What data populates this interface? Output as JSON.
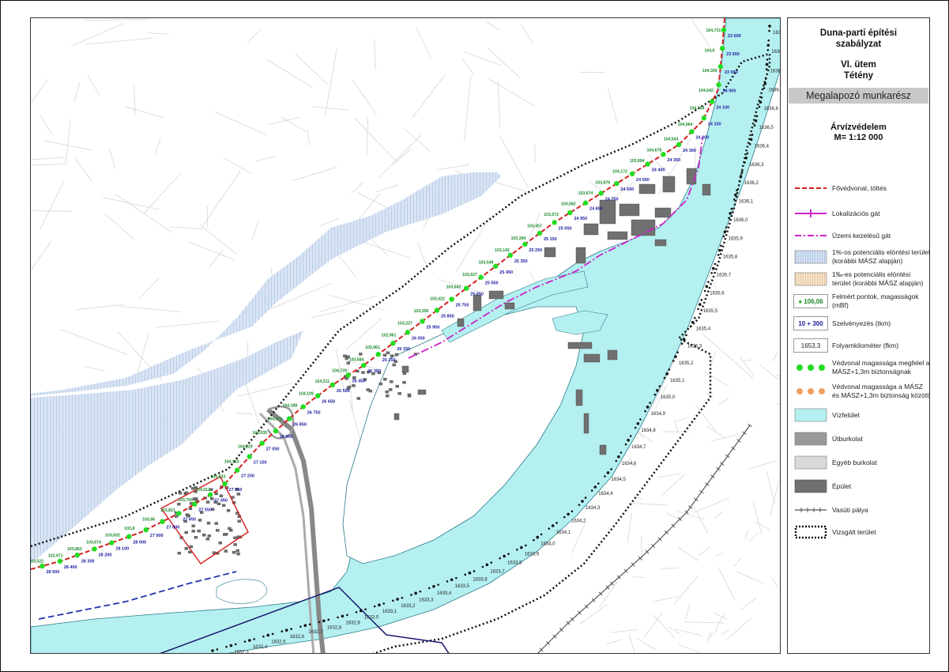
{
  "legend_header": {
    "title_1": "Duna-parti építési",
    "title_2": "szabályzat",
    "stage": "VI. ütem",
    "district": "Tétény",
    "banner": "Megalapozó munkarész",
    "theme": "Árvízvédelem",
    "scale": "M= 1:12 000"
  },
  "legend_items": [
    {
      "label": "Fővédvonal, töltés",
      "symbol": "red-dashed-line",
      "color": "#d42020"
    },
    {
      "label": "Lokalizációs gát",
      "symbol": "magenta-ticked-line",
      "color": "#cc22cc"
    },
    {
      "label": "Üzemi kezelésű gát",
      "symbol": "magenta-dashdot-line",
      "color": "#cc22cc"
    },
    {
      "label": "1%-os potenciális elöntési terület (korábbi MÁSZ alapján)",
      "symbol": "blue-hatch",
      "color": "#9db8dc"
    },
    {
      "label": "1‰-es potenciális elöntési terület (korábbi MÁSZ alapján)",
      "symbol": "orange-hatch",
      "color": "#e8c79a"
    },
    {
      "label": "Felmért pontok, magasságok (mBf)",
      "symbol": "survey-point",
      "sample": "106,06",
      "color": "#1a8a2a"
    },
    {
      "label": "Szelvényezés (tkm)",
      "symbol": "chainage",
      "sample": "10 + 300",
      "color": "#1a1aa0"
    },
    {
      "label": "Folyamkilométer (fkm)",
      "symbol": "river-km-box",
      "sample": "1653,3"
    },
    {
      "label": "Védvonal magassága megfelel a MÁSZ+1,3m biztonságnak",
      "symbol": "green-dots",
      "color": "#22dd22"
    },
    {
      "label": "Védvonal magassága a MÁSZ és MÁSZ+1,3m biztonság közötti",
      "symbol": "orange-dots",
      "color": "#f0a060"
    },
    {
      "label": "Vízfelület",
      "symbol": "water-fill",
      "color": "#b5f0f0"
    },
    {
      "label": "Útburkolat",
      "symbol": "gray-fill",
      "color": "#999999"
    },
    {
      "label": "Egyéb burkolat",
      "symbol": "lightgray-fill",
      "color": "#d9d9d9"
    },
    {
      "label": "Épület",
      "symbol": "darkgray-fill",
      "color": "#707070"
    },
    {
      "label": "Vasúti pálya",
      "symbol": "rail-line",
      "color": "#555555"
    },
    {
      "label": "Vizsgált terület",
      "symbol": "black-dotted-outline",
      "color": "#111111"
    }
  ],
  "river_km_labels": [
    "1637",
    "1636,9",
    "1636,8",
    "1636,7",
    "1636,6",
    "1636,5",
    "1636,4",
    "1636,3",
    "1636,2",
    "1636,1",
    "1636,0",
    "1635,9",
    "1635,8",
    "1635,7",
    "1635,6",
    "1635,5",
    "1635,4",
    "1635,3",
    "1635,2",
    "1635,1",
    "1635,0",
    "1634,9",
    "1634,8",
    "1634,7",
    "1634,6",
    "1634,5",
    "1634,4",
    "1634,3",
    "1634,2",
    "1634,1",
    "1634,0",
    "1633,9",
    "1633,8",
    "1633,7",
    "1633,6",
    "1633,5",
    "1633,4",
    "1633,3",
    "1633,2",
    "1633,1",
    "1633,0",
    "1632,9",
    "1632,8",
    "1632,7",
    "1632,6",
    "1632,5",
    "1632,4",
    "1632,3",
    "1632,2"
  ],
  "chainage_labels": [
    "23 600",
    "23 650",
    "23 950",
    "24 000",
    "24 100",
    "24 150",
    "24 200",
    "24 300",
    "24 350",
    "24 400",
    "24 550",
    "24 650",
    "24 750",
    "24 850",
    "24 950",
    "25 050",
    "25 150",
    "25 250",
    "25 350",
    "25 450",
    "25 550",
    "25 650",
    "25 750",
    "25 850",
    "25 950",
    "26 050",
    "26 150",
    "26 250",
    "26 350",
    "26 450",
    "26 550",
    "26 650",
    "26 750",
    "26 850",
    "26 900",
    "27 050",
    "27 150",
    "27 250",
    "27 350",
    "27 450",
    "27 550",
    "27 650",
    "27 800",
    "27 900",
    "28 000",
    "28 100",
    "28 200",
    "28 300",
    "28 400",
    "28 500"
  ],
  "elevation_labels": [
    "104,731",
    "104,6",
    "104,359",
    "104,642",
    "104,764",
    "104,964",
    "104,544",
    "104,678",
    "103,994",
    "104,172",
    "103,876",
    "103,674",
    "103,582",
    "103,572",
    "103,457",
    "103,394",
    "103,142",
    "103,549",
    "103,627",
    "103,642",
    "103,422",
    "103,356",
    "103,227",
    "102,961",
    "102,961",
    "103,584",
    "104,729",
    "104,211",
    "104,109",
    "104,188",
    "104,076",
    "104,035",
    "104,229",
    "104,143",
    "103,833",
    "104,012",
    "103,765",
    "103,821",
    "103,86",
    "103,8",
    "103,632",
    "103,674",
    "103,863",
    "103,971",
    "103,522"
  ]
}
